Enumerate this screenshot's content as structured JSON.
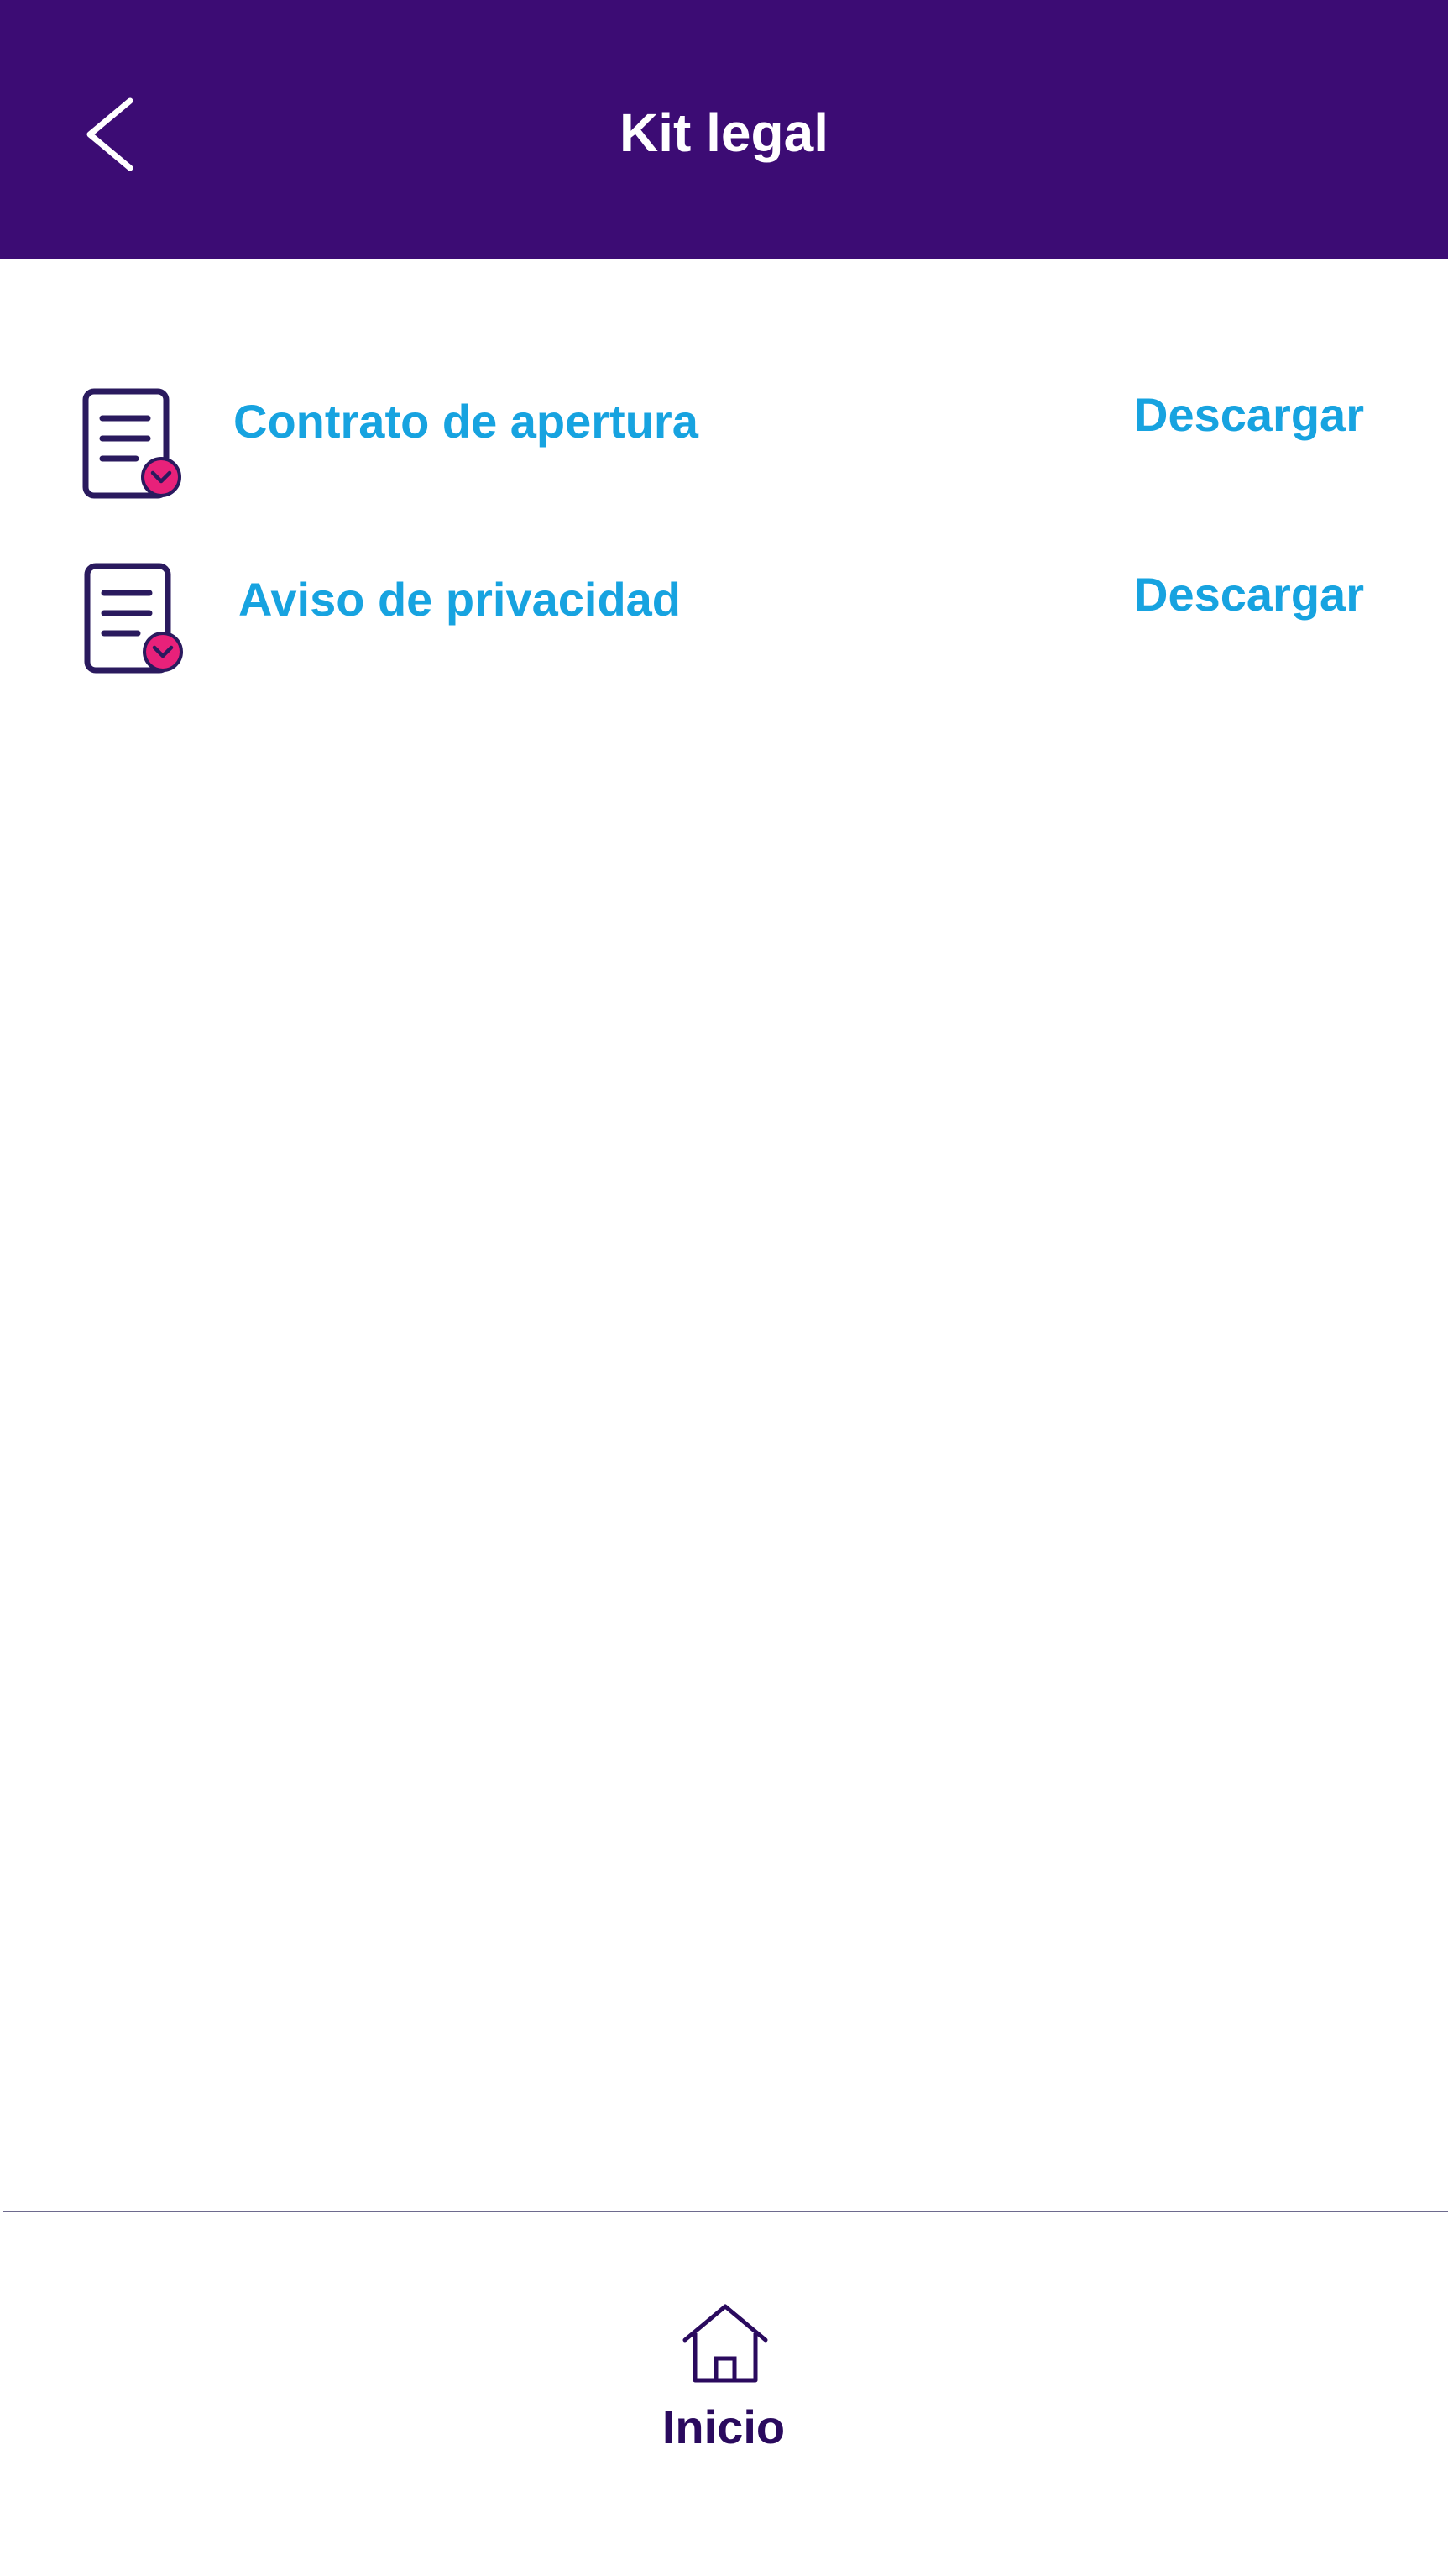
{
  "header": {
    "title": "Kit legal",
    "back_icon": "chevron-left-icon"
  },
  "documents": [
    {
      "label": "Contrato de apertura",
      "action_label": "Descargar",
      "icon": "document-download-icon"
    },
    {
      "label": "Aviso de privacidad",
      "action_label": "Descargar",
      "icon": "document-download-icon"
    }
  ],
  "bottom_nav": {
    "items": [
      {
        "label": "Inicio",
        "icon": "home-icon"
      }
    ]
  },
  "colors": {
    "header_bg": "#3c0c74",
    "link": "#17a3e0",
    "icon_stroke": "#2a1a5e",
    "badge": "#e8217a",
    "nav_label": "#2a0a5e"
  }
}
